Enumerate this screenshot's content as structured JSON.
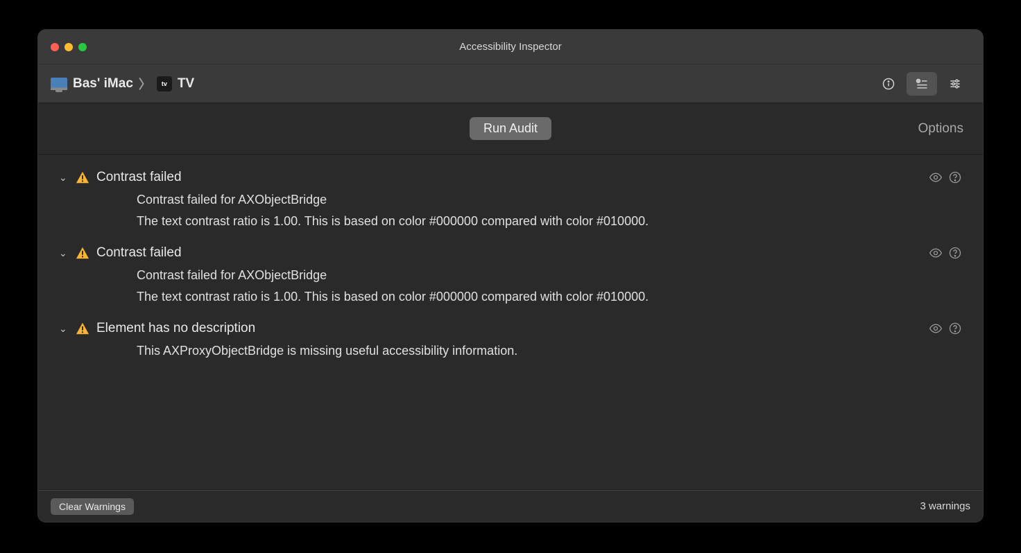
{
  "window": {
    "title": "Accessibility Inspector"
  },
  "breadcrumb": {
    "device_label": "Bas' iMac",
    "app_label": "TV",
    "app_icon_text": "tv"
  },
  "audit": {
    "run_button": "Run Audit",
    "options_label": "Options"
  },
  "issues": [
    {
      "title": "Contrast failed",
      "line1": "Contrast failed for AXObjectBridge",
      "line2": "The text contrast ratio is 1.00. This is based on color #000000 compared with color #010000."
    },
    {
      "title": "Contrast failed",
      "line1": "Contrast failed for AXObjectBridge",
      "line2": "The text contrast ratio is 1.00. This is based on color #000000 compared with color #010000."
    },
    {
      "title": "Element has no description",
      "line1": "This AXProxyObjectBridge is missing useful accessibility information.",
      "line2": ""
    }
  ],
  "footer": {
    "clear_label": "Clear Warnings",
    "count_label": "3 warnings"
  },
  "icons": {
    "warning": "warning-triangle-icon",
    "eye": "eye-icon",
    "help": "help-circle-icon",
    "info": "info-circle-icon",
    "audit_list": "audit-list-icon",
    "settings": "sliders-icon"
  }
}
